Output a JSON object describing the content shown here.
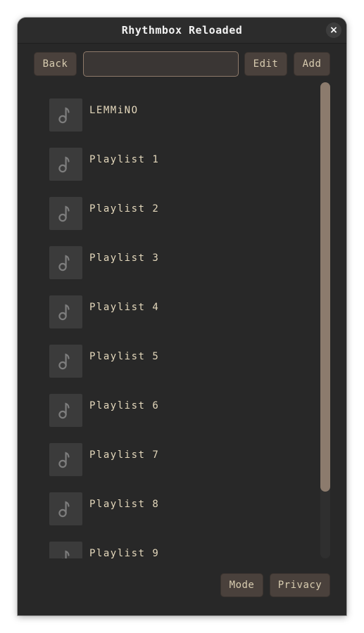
{
  "window": {
    "title": "Rhythmbox Reloaded",
    "close_glyph": "×"
  },
  "toolbar": {
    "back_label": "Back",
    "search_value": "",
    "search_placeholder": "",
    "edit_label": "Edit",
    "add_label": "Add"
  },
  "playlists": [
    {
      "label": "LEMMiNO",
      "icon": "music-note-icon"
    },
    {
      "label": "Playlist 1",
      "icon": "music-note-icon"
    },
    {
      "label": "Playlist 2",
      "icon": "music-note-icon"
    },
    {
      "label": "Playlist 3",
      "icon": "music-note-icon"
    },
    {
      "label": "Playlist 4",
      "icon": "music-note-icon"
    },
    {
      "label": "Playlist 5",
      "icon": "music-note-icon"
    },
    {
      "label": "Playlist 6",
      "icon": "music-note-icon"
    },
    {
      "label": "Playlist 7",
      "icon": "music-note-icon"
    },
    {
      "label": "Playlist 8",
      "icon": "music-note-icon"
    },
    {
      "label": "Playlist 9",
      "icon": "music-note-icon"
    }
  ],
  "footer": {
    "mode_label": "Mode",
    "privacy_label": "Privacy"
  },
  "colors": {
    "background": "#282828",
    "button": "#4a413c",
    "text": "#e4d8bc",
    "accent": "#8c7b6d"
  }
}
